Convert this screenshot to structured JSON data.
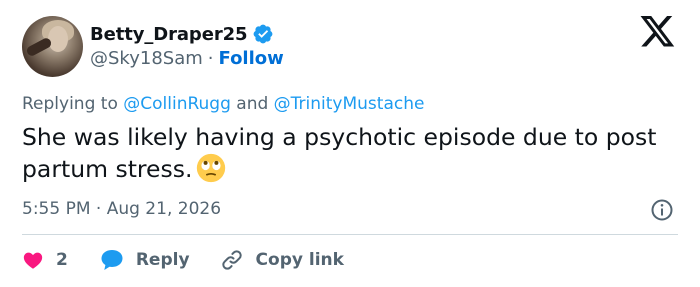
{
  "author": {
    "display_name": "Betty_Draper25",
    "handle": "@Sky18Sam",
    "separator": "·",
    "follow_label": "Follow",
    "verified": true
  },
  "reply_context": {
    "prefix": "Replying to",
    "mention_1": "@CollinRugg",
    "conjunction": "and",
    "mention_2": "@TrinityMustache"
  },
  "tweet": {
    "text": "She was likely having a psychotic episode due to post partum stress.",
    "emoji": "face-with-rolling-eyes",
    "timestamp": "5:55 PM · Aug 21, 2026"
  },
  "actions": {
    "like_count": "2",
    "reply_label": "Reply",
    "copy_link_label": "Copy link"
  },
  "colors": {
    "link_blue": "#1d9bf0",
    "follow_blue": "#006fd6",
    "secondary_text": "#536471",
    "like_pink": "#f91880",
    "divider": "#cfd9de"
  }
}
